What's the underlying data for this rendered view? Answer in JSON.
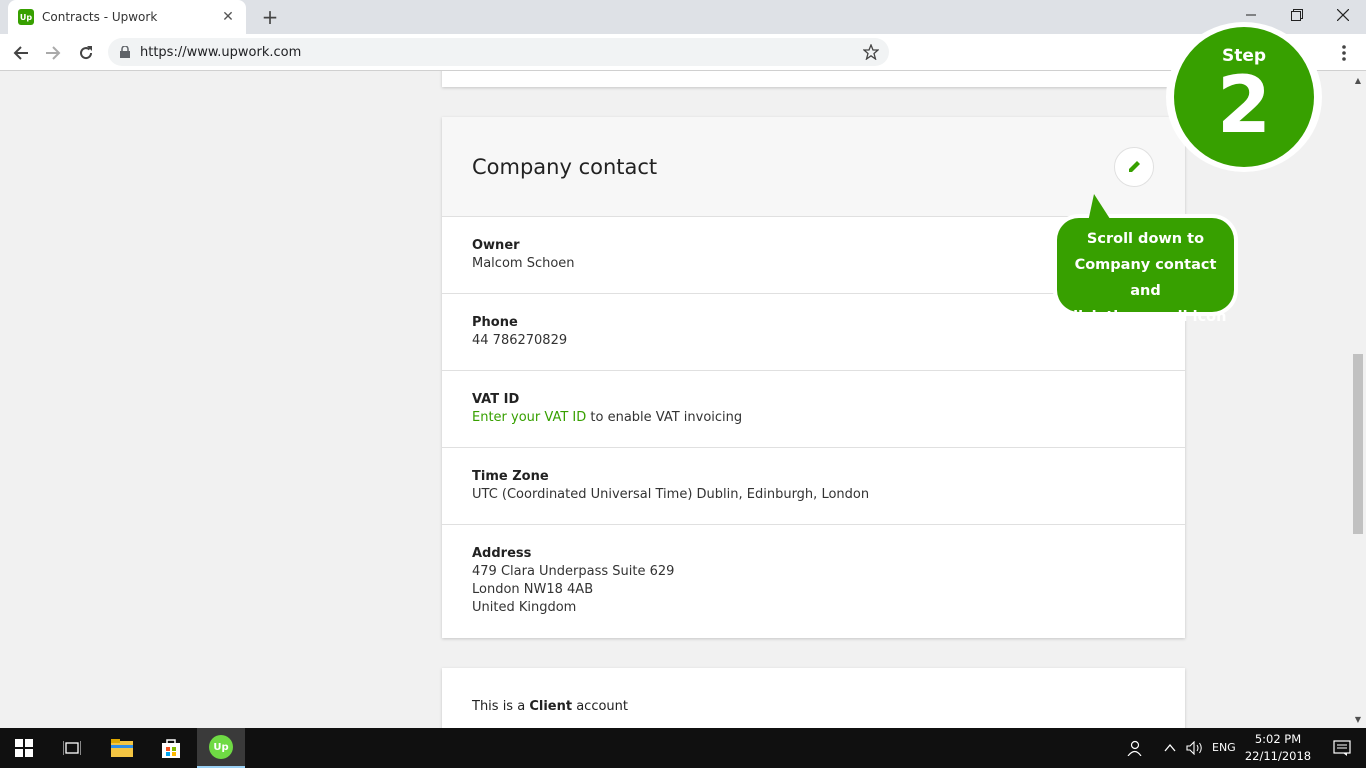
{
  "browser": {
    "tab_title": "Contracts - Upwork",
    "favicon_text": "Up",
    "close_glyph": "✕",
    "new_tab_glyph": "+",
    "url": "https://www.upwork.com"
  },
  "company_contact": {
    "title": "Company contact",
    "owner_label": "Owner",
    "owner_value": "Malcom Schoen",
    "phone_label": "Phone",
    "phone_value": "44 786270829",
    "vat_label": "VAT ID",
    "vat_link": "Enter your VAT ID",
    "vat_rest": " to enable VAT invoicing",
    "timezone_label": "Time Zone",
    "timezone_value": "UTC (Coordinated Universal Time) Dublin, Edinburgh, London",
    "address_label": "Address",
    "address_line1": "479 Clara Underpass Suite 629",
    "address_line2": "London NW18 4AB",
    "address_line3": "United Kingdom"
  },
  "account": {
    "prefix": "This is a ",
    "type": "Client",
    "suffix": " account"
  },
  "overlay": {
    "step_word": "Step",
    "step_number": "2",
    "tooltip_line1": "Scroll down to",
    "tooltip_line2": "Company contact and",
    "tooltip_line3": "click the pencil icon"
  },
  "taskbar": {
    "language": "ENG",
    "time": "5:02 PM",
    "date": "22/11/2018",
    "upwork_text": "Up"
  },
  "colors": {
    "brand_green": "#37a000",
    "tab_strip": "#dee1e6",
    "taskbar": "#101010"
  }
}
